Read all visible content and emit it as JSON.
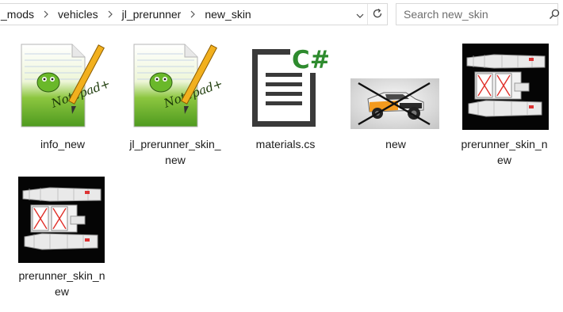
{
  "breadcrumb": {
    "segments": [
      "_mods",
      "vehicles",
      "jl_prerunner",
      "new_skin"
    ]
  },
  "search": {
    "placeholder": "Search new_skin"
  },
  "icons": {
    "separator": "chevron-right-icon",
    "dropdown": "chevron-down-icon",
    "refresh": "refresh-icon",
    "search": "search-icon",
    "notepad": "notepadpp-file-icon",
    "csharp": "csharp-file-icon"
  },
  "files": [
    {
      "label_lines": [
        "info_new"
      ],
      "kind": "notepadpp"
    },
    {
      "label_lines": [
        "jl_prerunner_skin_",
        "new"
      ],
      "kind": "notepadpp"
    },
    {
      "label_lines": [
        "materials.cs"
      ],
      "kind": "csharp"
    },
    {
      "label_lines": [
        "new"
      ],
      "kind": "image-preview"
    },
    {
      "label_lines": [
        "prerunner_skin_n",
        "ew"
      ],
      "kind": "skin-texture"
    },
    {
      "label_lines": [
        "prerunner_skin_n",
        "ew"
      ],
      "kind": "skin-texture"
    }
  ],
  "colors": {
    "csharp_green": "#2e8b2e",
    "notepad_green": "#6ab82a",
    "pencil_yellow": "#f2b01e"
  }
}
